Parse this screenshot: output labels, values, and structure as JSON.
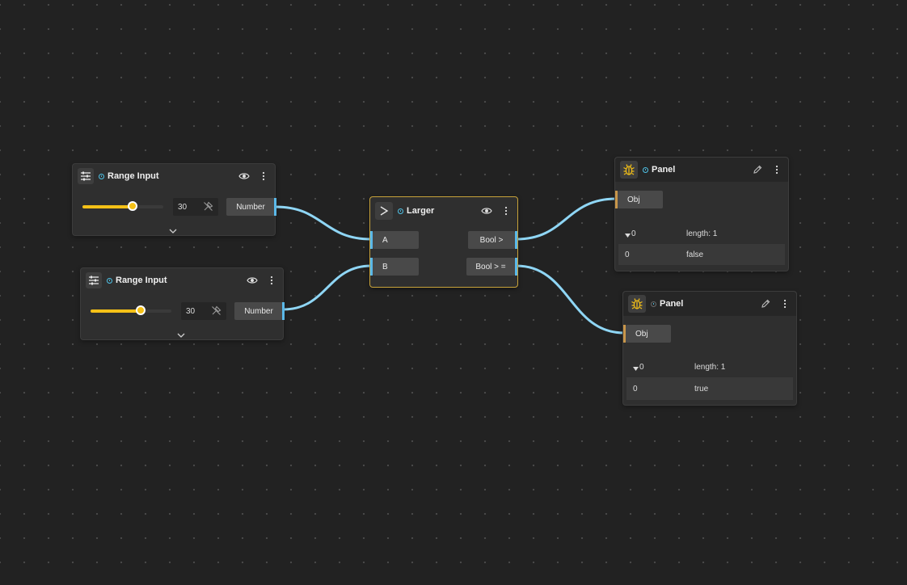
{
  "colors": {
    "canvas": "#222222",
    "node": "#2f2f2f",
    "wire": "#8fd6f5",
    "accent_yellow": "#f5c117",
    "port_blue": "#5ab8e8",
    "port_orange": "#c8964a",
    "selected_border": "#c8a33a"
  },
  "range_inputs": [
    {
      "title": "Range Input",
      "icon": "sliders-icon",
      "value": "30",
      "fraction": 0.62,
      "output_label": "Number"
    },
    {
      "title": "Range Input",
      "icon": "sliders-icon",
      "value": "30",
      "fraction": 0.62,
      "output_label": "Number"
    }
  ],
  "larger": {
    "title": "Larger",
    "icon": "greater-than-icon",
    "inputs": [
      "A",
      "B"
    ],
    "outputs": [
      "Bool >",
      "Bool > ="
    ]
  },
  "panels": [
    {
      "title": "Panel",
      "icon": "bug-icon",
      "input_label": "Obj",
      "rows": [
        {
          "key": "0",
          "value": "length: 1",
          "expanded": true
        },
        {
          "key": "0",
          "value": "false"
        }
      ]
    },
    {
      "title": "Panel",
      "icon": "bug-icon",
      "input_label": "Obj",
      "rows": [
        {
          "key": "0",
          "value": "length: 1",
          "expanded": true
        },
        {
          "key": "0",
          "value": "true"
        }
      ]
    }
  ]
}
